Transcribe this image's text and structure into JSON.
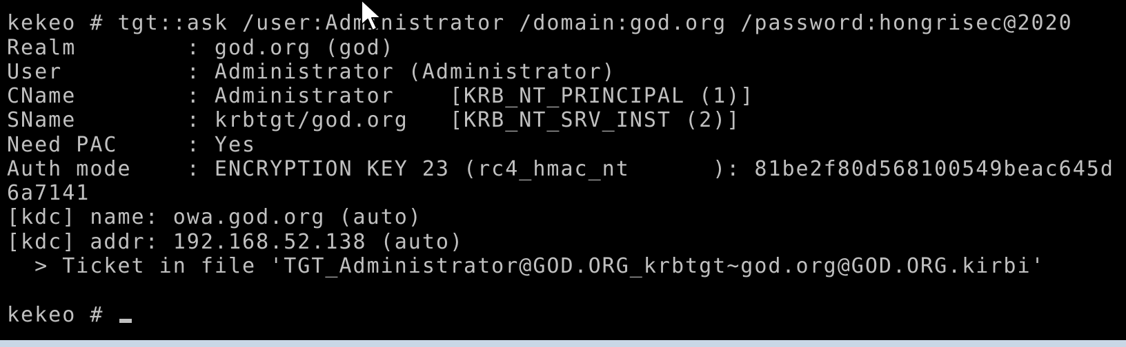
{
  "console": {
    "lines": [
      "kekeo # tgt::ask /user:Administrator /domain:god.org /password:hongrisec@2020",
      "Realm        : god.org (god)",
      "User         : Administrator (Administrator)",
      "CName        : Administrator    [KRB_NT_PRINCIPAL (1)]",
      "SName        : krbtgt/god.org   [KRB_NT_SRV_INST (2)]",
      "Need PAC     : Yes",
      "Auth mode    : ENCRYPTION KEY 23 (rc4_hmac_nt      ): 81be2f80d568100549beac645d",
      "6a7141",
      "[kdc] name: owa.god.org (auto)",
      "[kdc] addr: 192.168.52.138 (auto)",
      "  > Ticket in file 'TGT_Administrator@GOD.ORG_krbtgt~god.org@GOD.ORG.kirbi'",
      "",
      "kekeo # "
    ]
  },
  "colors": {
    "background": "#000000",
    "text": "#c0c0c0",
    "frame": "#c9d7e6"
  },
  "icons": {
    "pointer": "mouse-pointer-icon"
  }
}
